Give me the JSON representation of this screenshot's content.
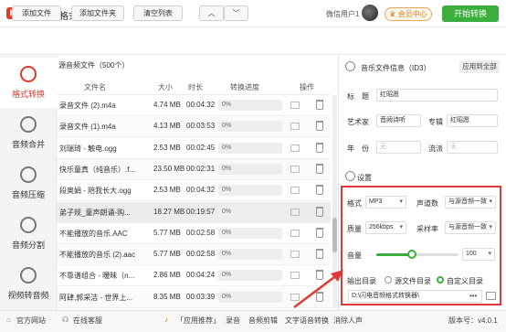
{
  "app": {
    "title": "闪电音频格式转换器",
    "user": "微信用户1",
    "member_label": "会员中心"
  },
  "window": {
    "menu": "≡",
    "minimize": "—",
    "close": "✕"
  },
  "toolbar": {
    "add_file": "添加文件",
    "add_folder": "添加文件夹",
    "clear_list": "清空列表",
    "up": "︿",
    "down": "﹀",
    "start": "开始转换"
  },
  "sidebar": {
    "items": [
      {
        "label": "格式转换",
        "icon": "refresh-icon",
        "active": true
      },
      {
        "label": "音频合并",
        "icon": "merge-icon"
      },
      {
        "label": "音频压缩",
        "icon": "compress-icon"
      },
      {
        "label": "音频分割",
        "icon": "split-icon"
      },
      {
        "label": "视频转音频",
        "icon": "video-icon"
      }
    ]
  },
  "list": {
    "header": "源音频文件（500个）",
    "columns": [
      "文件名",
      "大小",
      "时长",
      "转换进度",
      "操作"
    ],
    "rows": [
      {
        "name": "录音文件 (2).m4a",
        "size": "4.74 MB",
        "duration": "00:04:32",
        "progress": "0%"
      },
      {
        "name": "录音文件 (1).m4a",
        "size": "4.13 MB",
        "duration": "00:03:53",
        "progress": "0%"
      },
      {
        "name": "刘瑞琦 - 触电.ogg",
        "size": "2.53 MB",
        "duration": "00:02:45",
        "progress": "0%"
      },
      {
        "name": "快乐童真（纯音乐）.f...",
        "size": "23.50 MB",
        "duration": "00:02:31",
        "progress": "0%"
      },
      {
        "name": "段奥娟 - 陪我长大.ogg",
        "size": "2.53 MB",
        "duration": "00:04:32",
        "progress": "0%"
      },
      {
        "name": "弟子规_童声朗诵-购...",
        "size": "18.27 MB",
        "duration": "00:19:57",
        "progress": "0%"
      },
      {
        "name": "不能播放的音乐.AAC",
        "size": "5.77 MB",
        "duration": "00:02:58",
        "progress": "0%"
      },
      {
        "name": "不能播放的音乐 (2).aac",
        "size": "5.77 MB",
        "duration": "00:02:58",
        "progress": "0%"
      },
      {
        "name": "不靠谱组合 - 暧昧（n...",
        "size": "2.86 MB",
        "duration": "00:04:24",
        "progress": "0%"
      },
      {
        "name": "阿肆,郭采洁 - 世界上...",
        "size": "8.35 MB",
        "duration": "00:03:39",
        "progress": "0%"
      }
    ]
  },
  "info": {
    "title": "音乐文件信息（ID3）",
    "apply_dir": "应用到全部",
    "title_label": "标　题",
    "title_value": "红昭愿",
    "artist_label": "艺术家",
    "artist_value": "音阙诗听",
    "album_label": "专辑",
    "album_value": "红昭愿",
    "year_label": "年　份",
    "year_value": "无",
    "genre_label": "流派",
    "genre_value": "无"
  },
  "settings": {
    "title": "设置",
    "format_label": "格式",
    "format_value": "MP3",
    "channel_label": "声道数",
    "channel_value": "与源音频一致",
    "quality_label": "质量",
    "quality_value": "256kbps",
    "samplerate_label": "采样率",
    "samplerate_value": "与源音频一致",
    "volume_label": "音量",
    "volume_value": "100",
    "volume_level": 0.43,
    "output_label": "输出目录",
    "opt_source": "源文件目录",
    "opt_custom": "自定义目录",
    "output_path": "D:\\闪电音频格式转换器\\",
    "dots": "•••"
  },
  "status": {
    "website": "官方网站",
    "support": "在线客服",
    "recommend_label": "「应用推荐」",
    "apps": [
      "录音",
      "音频剪辑",
      "文字语音转换",
      "消除人声"
    ],
    "version": "版本号：v4.0.1"
  }
}
